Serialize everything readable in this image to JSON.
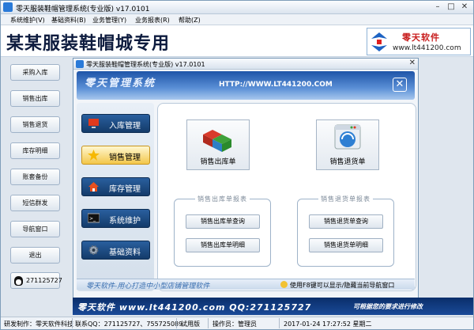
{
  "window": {
    "title": "零天服装鞋帽管理系统(专业版) v17.0101"
  },
  "menu": [
    "系统维护(V)",
    "基础资料(B)",
    "业务管理(Y)",
    "业务报表(R)",
    "帮助(Z)"
  ],
  "banner": {
    "title": "某某服装鞋帽城专用",
    "brand_name": "零天软件",
    "brand_url": "www.lt441200.com"
  },
  "sidebar": [
    "采购入库",
    "销售出库",
    "销售退货",
    "库存明细",
    "账套备份",
    "短信群发",
    "导航窗口",
    "退出"
  ],
  "qq": "271125727",
  "inner": {
    "title": "零天服装鞋帽管理系统(专业版) v17.0101",
    "header_title": "零天管理系统",
    "header_url": "HTTP://WWW.LT441200.COM",
    "nav": [
      "入库管理",
      "销售管理",
      "库存管理",
      "系统维护",
      "基础资料"
    ],
    "big_buttons": [
      "销售出库单",
      "销售退货单"
    ],
    "groups": [
      {
        "title": "销售出库单报表",
        "buttons": [
          "销售出库单查询",
          "销售出库单明细"
        ]
      },
      {
        "title": "销售退货单报表",
        "buttons": [
          "销售退货单查询",
          "销售退货单明细"
        ]
      }
    ],
    "status_left": "零天软件-用心打造中小型店铺管理软件",
    "status_right": "使用F8键可以显示/隐藏当前导航窗口"
  },
  "bluebar": {
    "left": "零天软件 www.lt441200.com QQ:271125727",
    "right": "可根据您的要求进行修改"
  },
  "statusbar": {
    "developer": "研发制作：零天软件科技",
    "qq": "联系QQ：271125727、755725089",
    "edition": "试用版",
    "operator": "操作员：管理员",
    "datetime": "2017-01-24 17:27:52 星期二"
  },
  "colors": {
    "accent": "#1e54a8",
    "highlight": "#f3c74a",
    "brand_red": "#c81c1c"
  }
}
